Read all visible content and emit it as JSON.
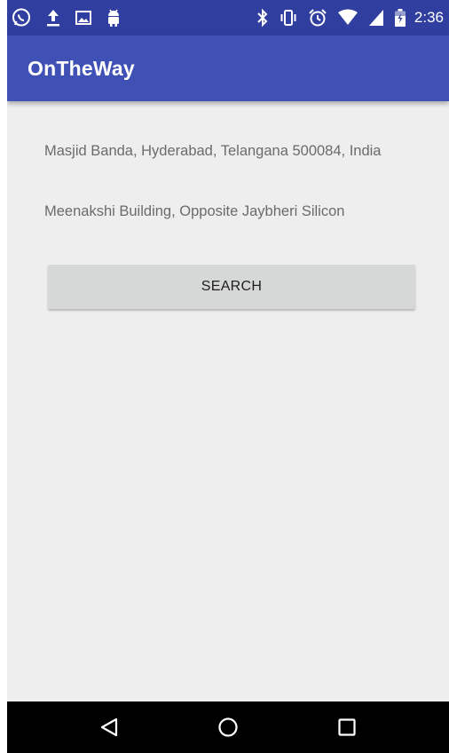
{
  "status_bar": {
    "time": "2:36",
    "left_icons": [
      "whatsapp-icon",
      "upload-icon",
      "image-icon",
      "android-icon"
    ],
    "right_icons": [
      "bluetooth-icon",
      "vibrate-icon",
      "alarm-icon",
      "wifi-icon",
      "signal-icon",
      "battery-icon"
    ]
  },
  "app_bar": {
    "title": "OnTheWay"
  },
  "main": {
    "source_address": "Masjid Banda, Hyderabad, Telangana 500084, India",
    "destination_address": "Meenakshi Building, Opposite Jaybheri Silicon",
    "search_label": "SEARCH"
  },
  "nav_bar": {
    "buttons": [
      "back-icon",
      "home-icon",
      "recents-icon"
    ]
  },
  "colors": {
    "status_bar": "#303f9f",
    "app_bar": "#3f51b5",
    "background": "#eeeeee",
    "button": "#d6d7d7"
  }
}
